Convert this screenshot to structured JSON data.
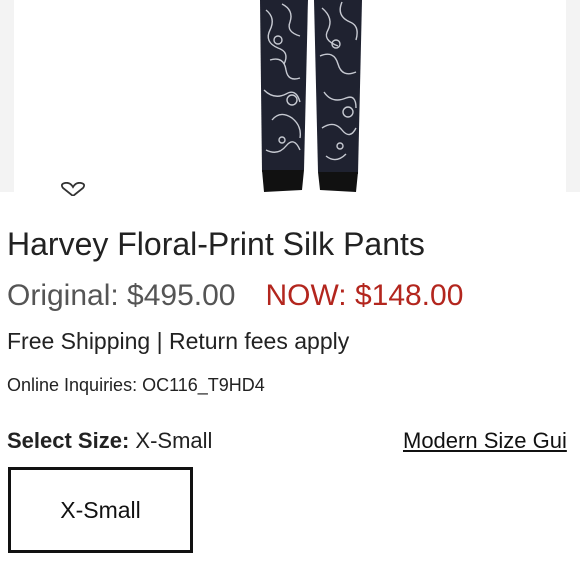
{
  "product": {
    "title": "Harvey Floral-Print Silk Pants",
    "price_original": "Original: $495.00",
    "price_now": "NOW: $148.00",
    "shipping": "Free Shipping | Return fees apply",
    "inquiries": "Online Inquiries: OC116_T9HD4"
  },
  "size": {
    "label": "Select Size:",
    "selected": "X-Small",
    "guide_link": "Modern Size Gui",
    "options": [
      "X-Small"
    ]
  },
  "icons": {
    "wishlist": "heart-icon"
  },
  "colors": {
    "sale_price": "#b3261e",
    "original_price": "#555555",
    "selected_border": "#111111"
  }
}
